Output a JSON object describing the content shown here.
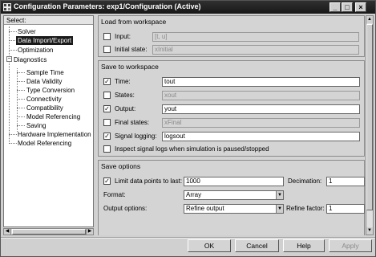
{
  "window": {
    "title": "Configuration Parameters: exp1/Configuration (Active)",
    "controls": [
      "_",
      "□",
      "×"
    ]
  },
  "tree": {
    "header": "Select:",
    "items": [
      {
        "label": "Solver"
      },
      {
        "label": "Data Import/Export",
        "selected": true
      },
      {
        "label": "Optimization"
      },
      {
        "label": "Diagnostics",
        "expander": "−"
      },
      {
        "label": "Sample Time"
      },
      {
        "label": "Data Validity"
      },
      {
        "label": "Type Conversion"
      },
      {
        "label": "Connectivity"
      },
      {
        "label": "Compatibility"
      },
      {
        "label": "Model Referencing"
      },
      {
        "label": "Saving"
      },
      {
        "label": "Hardware Implementation"
      },
      {
        "label": "Model Referencing"
      }
    ]
  },
  "load": {
    "title": "Load from workspace",
    "input_label": "Input:",
    "input_value": "[t, u]",
    "input_checked": false,
    "initial_label": "Initial state:",
    "initial_value": "xInitial",
    "initial_checked": false
  },
  "save": {
    "title": "Save to workspace",
    "time_label": "Time:",
    "time_value": "tout",
    "time_checked": true,
    "states_label": "States:",
    "states_value": "xout",
    "states_checked": false,
    "output_label": "Output:",
    "output_value": "yout",
    "output_checked": true,
    "final_label": "Final states:",
    "final_value": "xFinal",
    "final_checked": false,
    "sig_label": "Signal logging:",
    "sig_value": "logsout",
    "sig_checked": true,
    "inspect_label": "Inspect signal logs when simulation is paused/stopped",
    "inspect_checked": false
  },
  "options": {
    "title": "Save options",
    "limit_label": "Limit data points to last:",
    "limit_value": "1000",
    "limit_checked": true,
    "decimation_label": "Decimation:",
    "decimation_value": "1",
    "format_label": "Format:",
    "format_value": "Array",
    "outopt_label": "Output options:",
    "outopt_value": "Refine output",
    "refine_label": "Refine factor:",
    "refine_value": "1"
  },
  "buttons": {
    "ok": "OK",
    "cancel": "Cancel",
    "help": "Help",
    "apply": "Apply"
  },
  "glyphs": {
    "check": "✓",
    "dropdown": "▼",
    "left": "◀",
    "right": "▶",
    "up": "▲",
    "down": "▼"
  }
}
